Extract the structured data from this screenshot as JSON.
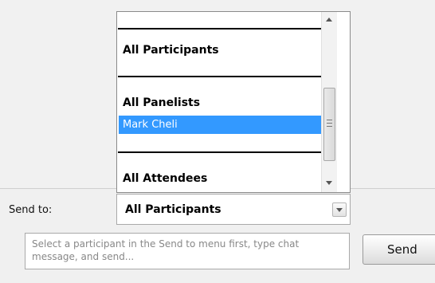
{
  "recipients_list": {
    "items": [
      {
        "label": "All Participants",
        "style": "bold"
      },
      {
        "label": "All Panelists",
        "style": "bold"
      },
      {
        "label": "Mark Cheli",
        "style": "selected"
      },
      {
        "label": "All Attendees",
        "style": "bold"
      }
    ],
    "scrollbar": {
      "up_icon": "arrow-up-icon",
      "down_icon": "arrow-down-icon",
      "thumb_icon": "grip-icon"
    }
  },
  "send_to": {
    "label": "Send to:",
    "selected_value": "All Participants",
    "dropdown_icon": "chevron-down-icon"
  },
  "message_input": {
    "placeholder": "Select a participant in the Send to menu first, type chat message, and send..."
  },
  "send_button": {
    "label": "Send"
  },
  "colors": {
    "selection": "#3399ff",
    "background": "#f1f1f1"
  }
}
